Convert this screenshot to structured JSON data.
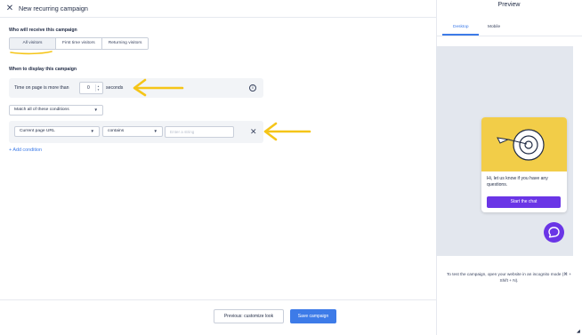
{
  "header": {
    "close_icon": "close-icon",
    "title": "New recurring campaign"
  },
  "audience": {
    "label": "Who will receive this campaign",
    "options": [
      "All visitors",
      "First time visitors",
      "Returning visitors"
    ],
    "selected": "All visitors"
  },
  "display": {
    "label": "When to display this campaign",
    "time_prefix": "Time on page is more than",
    "time_value": "0",
    "time_suffix": "seconds",
    "match_select": "Match all of these conditions",
    "condition_field": "Current page URL",
    "condition_operator": "contains",
    "condition_placeholder": "Enter a string",
    "add_condition": "+ Add condition"
  },
  "footer": {
    "previous_label": "Previous: customize look",
    "save_label": "Save campaign"
  },
  "preview": {
    "title": "Preview",
    "tabs": [
      "Desktop",
      "Mobile"
    ],
    "active_tab": "Desktop",
    "chat_message": "Hi, let us know if you have any questions.",
    "chat_button": "Start the chat",
    "test_note": "To test the campaign, open your website in an incognito mode (⌘ + Shift + N)."
  },
  "colors": {
    "accent": "#3d7be8",
    "chat_purple": "#6a35e6",
    "chat_header_yellow": "#f2cd48",
    "annotation_arrow": "#f5c518"
  }
}
